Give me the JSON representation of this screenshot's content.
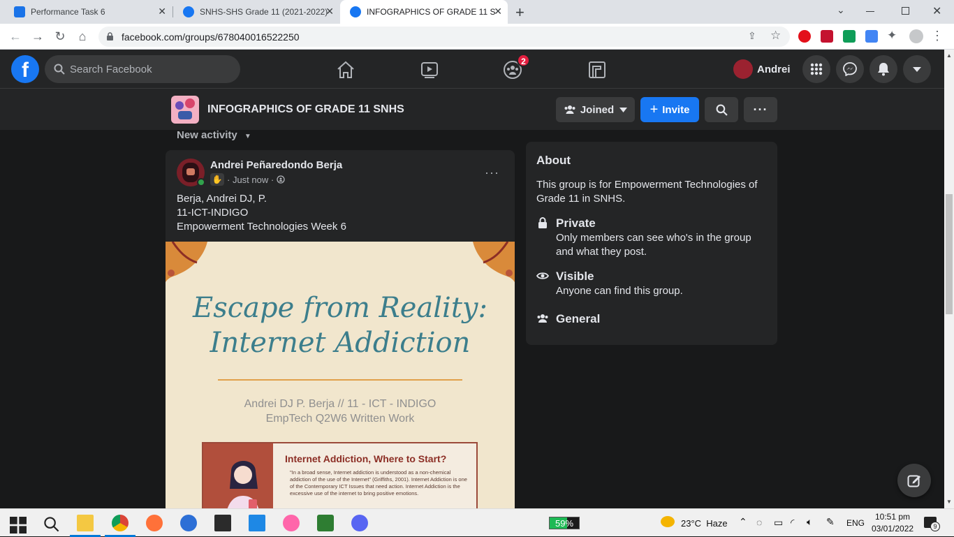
{
  "browser": {
    "tabs": [
      {
        "title": "Performance Task 6",
        "active": false
      },
      {
        "title": "SNHS-SHS Grade 11 (2021-2022)",
        "active": false
      },
      {
        "title": "INFOGRAPHICS OF GRADE 11 SNHS",
        "active": true
      }
    ],
    "url": "facebook.com/groups/678040016522250"
  },
  "fb": {
    "search_placeholder": "Search Facebook",
    "groups_badge": "2",
    "profile_name": "Andrei"
  },
  "group": {
    "name": "INFOGRAPHICS OF GRADE 11 SNHS",
    "joined_label": "Joined",
    "invite_label": "Invite"
  },
  "feed": {
    "sort_label": "New activity",
    "post": {
      "author": "Andrei Peñaredondo Berja",
      "time": "Just now",
      "text_lines": [
        "Berja, Andrei DJ, P.",
        "11-ICT-INDIGO",
        "Empowerment Technologies Week 6"
      ],
      "image": {
        "title_line1": "Escape from Reality:",
        "title_line2": "Internet Addiction",
        "subtitle_line1": "Andrei DJ P. Berja // 11 - ICT - INDIGO",
        "subtitle_line2": "EmpTech Q2W6 Written Work",
        "box_title": "Internet Addiction, Where to Start?",
        "box_text": "\"In a broad sense, Internet addiction is understood as a non-chemical addiction of the use of the Internet\" (Griffiths, 2001). Internet Addiction is one of the Contemporary ICT Issues that need action. Internet Addiction is the excessive use of the internet to bring positive emotions."
      }
    }
  },
  "about": {
    "title": "About",
    "description": "This group is for Empowerment Technologies of Grade 11 in SNHS.",
    "privacy_title": "Private",
    "privacy_desc": "Only members can see who's in the group and what they post.",
    "visibility_title": "Visible",
    "visibility_desc": "Anyone can find this group.",
    "category": "General"
  },
  "taskbar": {
    "battery": "59%",
    "weather": "23°C  Haze",
    "lang": "ENG",
    "time": "10:51 pm",
    "date": "03/01/2022",
    "notifications": "9"
  },
  "colors": {
    "fb_blue": "#1877f2",
    "bg_dark": "#18191a",
    "surface": "#242526",
    "infog_teal": "#3c7e8c"
  }
}
